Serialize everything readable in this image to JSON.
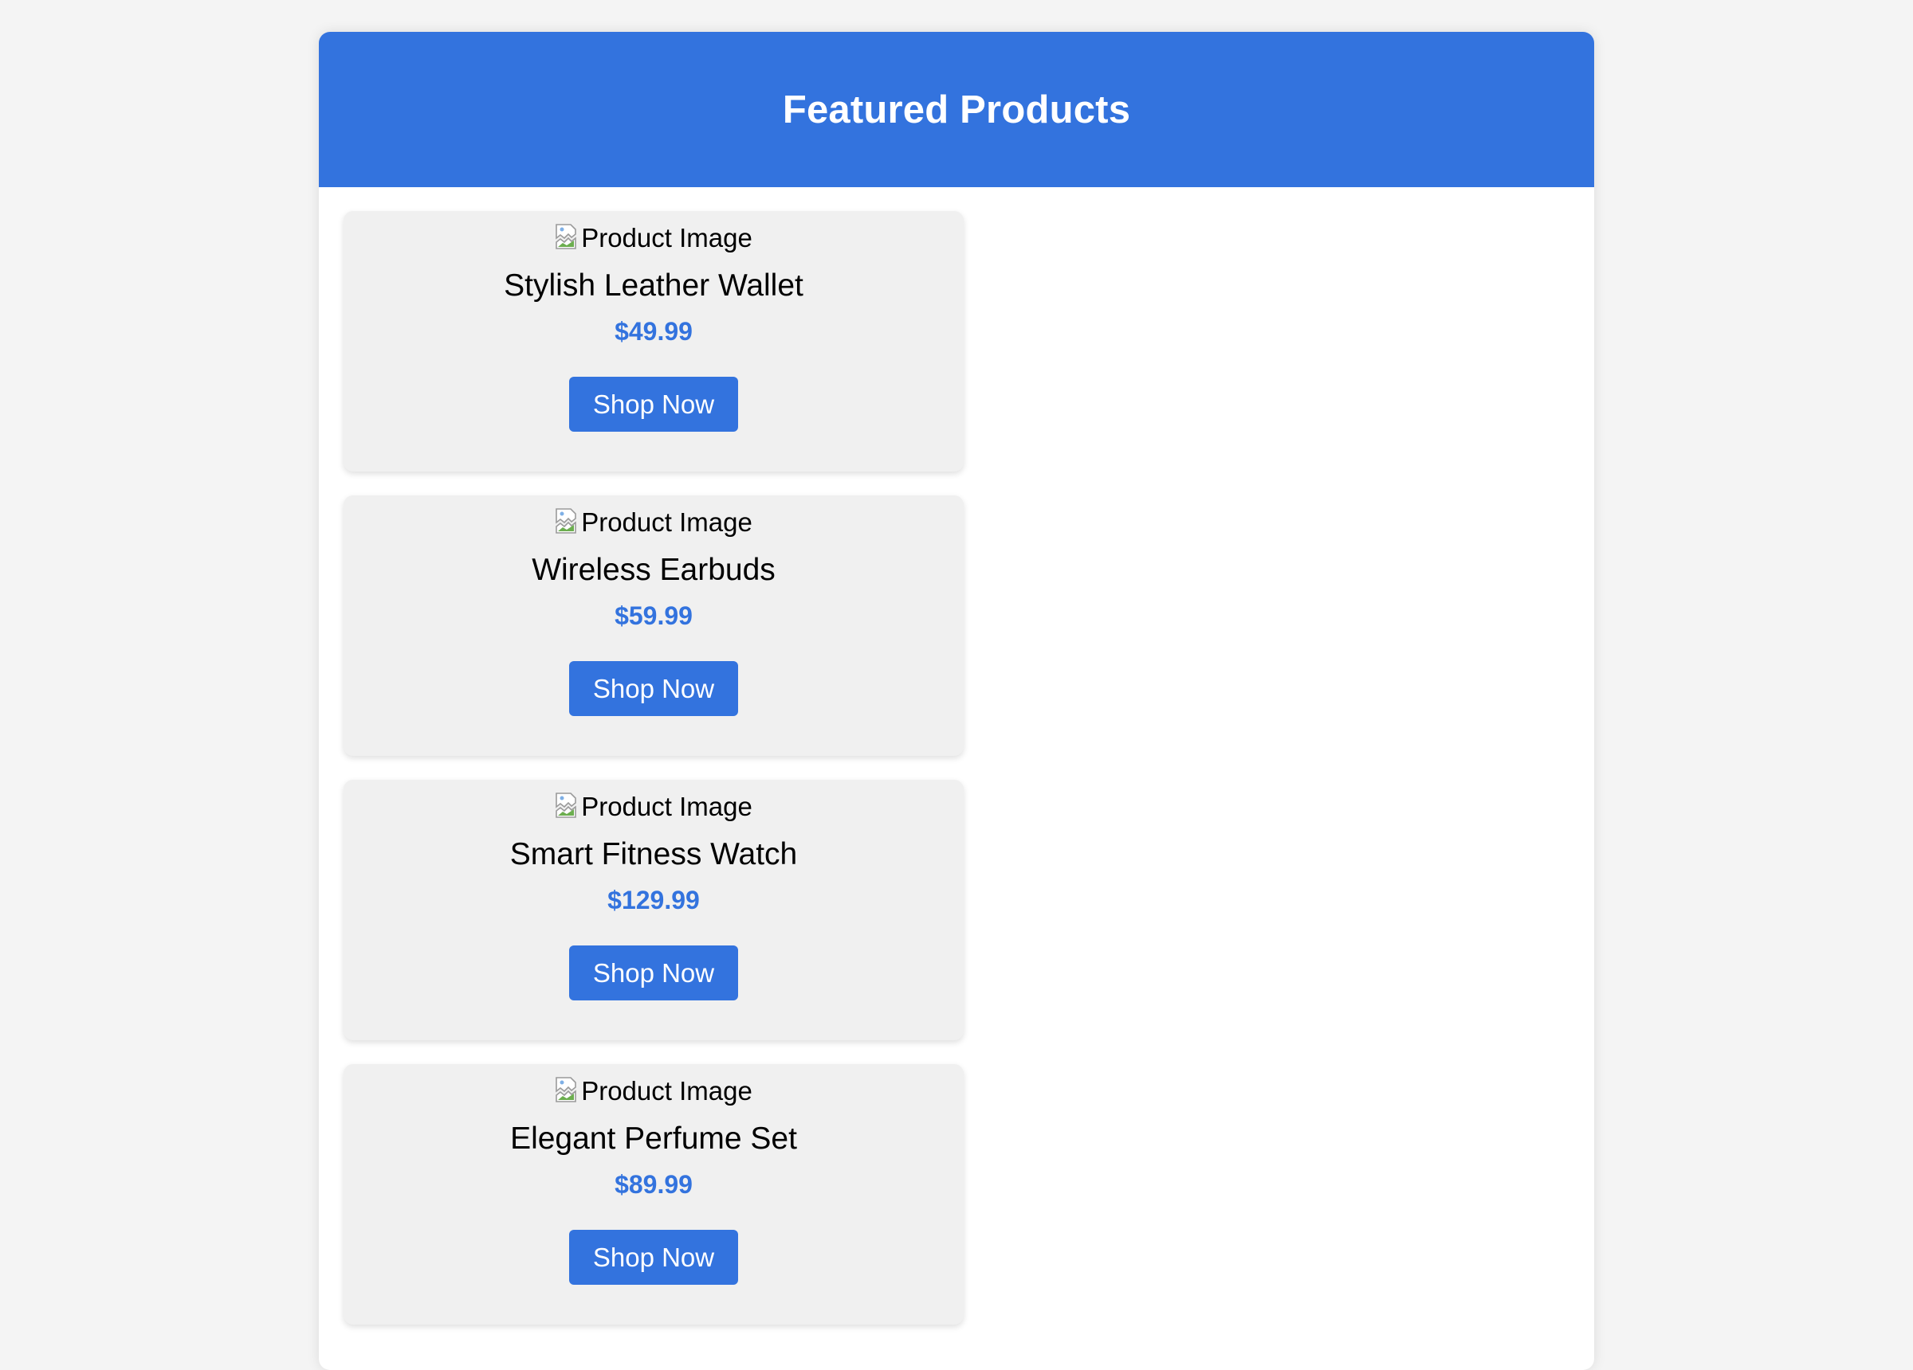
{
  "header": {
    "title": "Featured Products"
  },
  "colors": {
    "accent": "#3373de",
    "card_background": "#f0f0f0",
    "page_background": "#f4f4f4"
  },
  "products": [
    {
      "image_alt": "Product Image",
      "name": "Stylish Leather Wallet",
      "price": "$49.99",
      "button_label": "Shop Now"
    },
    {
      "image_alt": "Product Image",
      "name": "Wireless Earbuds",
      "price": "$59.99",
      "button_label": "Shop Now"
    },
    {
      "image_alt": "Product Image",
      "name": "Smart Fitness Watch",
      "price": "$129.99",
      "button_label": "Shop Now"
    },
    {
      "image_alt": "Product Image",
      "name": "Elegant Perfume Set",
      "price": "$89.99",
      "button_label": "Shop Now"
    }
  ]
}
